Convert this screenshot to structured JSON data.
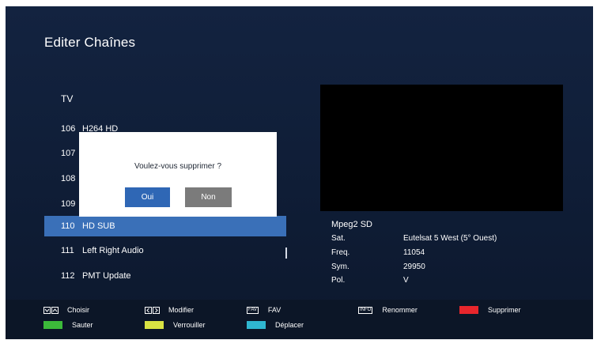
{
  "header": {
    "title": "Editer Chaînes"
  },
  "list": {
    "header": "TV",
    "channels": [
      {
        "num": "106",
        "name": "H264 HD"
      },
      {
        "num": "107",
        "name": ""
      },
      {
        "num": "108",
        "name": ""
      },
      {
        "num": "109",
        "name": ""
      },
      {
        "num": "110",
        "name": "HD SUB"
      },
      {
        "num": "111",
        "name": "Left Right Audio"
      },
      {
        "num": "112",
        "name": "PMT Update"
      }
    ],
    "selected_index": 4
  },
  "info": {
    "type": "Mpeg2 SD",
    "sat_label": "Sat.",
    "sat_value": "Eutelsat 5 West (5° Ouest)",
    "freq_label": "Freq.",
    "freq_value": "11054",
    "sym_label": "Sym.",
    "sym_value": "29950",
    "pol_label": "Pol.",
    "pol_value": "V"
  },
  "dialog": {
    "message": "Voulez-vous supprimer ?",
    "yes_label": "Oui",
    "no_label": "Non"
  },
  "footer": {
    "choisir": {
      "keys": [
        "chevron-down-icon",
        "chevron-up-icon"
      ],
      "label": "Choisir"
    },
    "modifier": {
      "keys": [
        "chevron-left-icon",
        "chevron-right-icon"
      ],
      "label": "Modifier"
    },
    "fav": {
      "key": "FAV",
      "label": "FAV"
    },
    "renommer": {
      "key": "INFO",
      "label": "Renommer"
    },
    "supprimer": {
      "color": "#e8262c",
      "label": "Supprimer"
    },
    "sauter": {
      "color": "#3cba3a",
      "label": "Sauter"
    },
    "verrouiller": {
      "color": "#d9e343",
      "label": "Verrouiller"
    },
    "deplacer": {
      "color": "#2fb6d0",
      "label": "Déplacer"
    }
  },
  "colors": {
    "background": "#132340",
    "selection": "#3a70b8",
    "yes_button": "#2f67b5",
    "no_button": "#7b7b7b"
  }
}
